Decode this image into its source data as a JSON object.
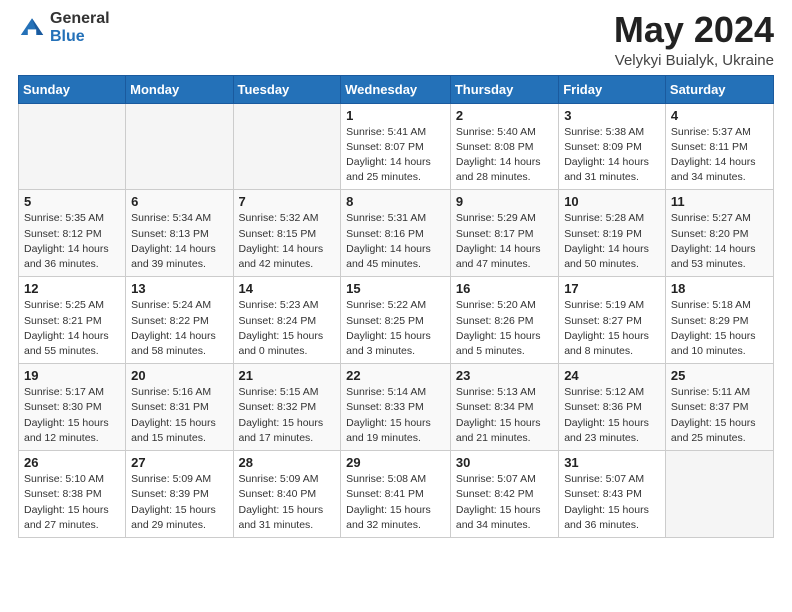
{
  "header": {
    "logo_general": "General",
    "logo_blue": "Blue",
    "title": "May 2024",
    "subtitle": "Velykyi Buialyk, Ukraine"
  },
  "columns": [
    "Sunday",
    "Monday",
    "Tuesday",
    "Wednesday",
    "Thursday",
    "Friday",
    "Saturday"
  ],
  "weeks": [
    [
      {
        "day": "",
        "info": ""
      },
      {
        "day": "",
        "info": ""
      },
      {
        "day": "",
        "info": ""
      },
      {
        "day": "1",
        "info": "Sunrise: 5:41 AM\nSunset: 8:07 PM\nDaylight: 14 hours\nand 25 minutes."
      },
      {
        "day": "2",
        "info": "Sunrise: 5:40 AM\nSunset: 8:08 PM\nDaylight: 14 hours\nand 28 minutes."
      },
      {
        "day": "3",
        "info": "Sunrise: 5:38 AM\nSunset: 8:09 PM\nDaylight: 14 hours\nand 31 minutes."
      },
      {
        "day": "4",
        "info": "Sunrise: 5:37 AM\nSunset: 8:11 PM\nDaylight: 14 hours\nand 34 minutes."
      }
    ],
    [
      {
        "day": "5",
        "info": "Sunrise: 5:35 AM\nSunset: 8:12 PM\nDaylight: 14 hours\nand 36 minutes."
      },
      {
        "day": "6",
        "info": "Sunrise: 5:34 AM\nSunset: 8:13 PM\nDaylight: 14 hours\nand 39 minutes."
      },
      {
        "day": "7",
        "info": "Sunrise: 5:32 AM\nSunset: 8:15 PM\nDaylight: 14 hours\nand 42 minutes."
      },
      {
        "day": "8",
        "info": "Sunrise: 5:31 AM\nSunset: 8:16 PM\nDaylight: 14 hours\nand 45 minutes."
      },
      {
        "day": "9",
        "info": "Sunrise: 5:29 AM\nSunset: 8:17 PM\nDaylight: 14 hours\nand 47 minutes."
      },
      {
        "day": "10",
        "info": "Sunrise: 5:28 AM\nSunset: 8:19 PM\nDaylight: 14 hours\nand 50 minutes."
      },
      {
        "day": "11",
        "info": "Sunrise: 5:27 AM\nSunset: 8:20 PM\nDaylight: 14 hours\nand 53 minutes."
      }
    ],
    [
      {
        "day": "12",
        "info": "Sunrise: 5:25 AM\nSunset: 8:21 PM\nDaylight: 14 hours\nand 55 minutes."
      },
      {
        "day": "13",
        "info": "Sunrise: 5:24 AM\nSunset: 8:22 PM\nDaylight: 14 hours\nand 58 minutes."
      },
      {
        "day": "14",
        "info": "Sunrise: 5:23 AM\nSunset: 8:24 PM\nDaylight: 15 hours\nand 0 minutes."
      },
      {
        "day": "15",
        "info": "Sunrise: 5:22 AM\nSunset: 8:25 PM\nDaylight: 15 hours\nand 3 minutes."
      },
      {
        "day": "16",
        "info": "Sunrise: 5:20 AM\nSunset: 8:26 PM\nDaylight: 15 hours\nand 5 minutes."
      },
      {
        "day": "17",
        "info": "Sunrise: 5:19 AM\nSunset: 8:27 PM\nDaylight: 15 hours\nand 8 minutes."
      },
      {
        "day": "18",
        "info": "Sunrise: 5:18 AM\nSunset: 8:29 PM\nDaylight: 15 hours\nand 10 minutes."
      }
    ],
    [
      {
        "day": "19",
        "info": "Sunrise: 5:17 AM\nSunset: 8:30 PM\nDaylight: 15 hours\nand 12 minutes."
      },
      {
        "day": "20",
        "info": "Sunrise: 5:16 AM\nSunset: 8:31 PM\nDaylight: 15 hours\nand 15 minutes."
      },
      {
        "day": "21",
        "info": "Sunrise: 5:15 AM\nSunset: 8:32 PM\nDaylight: 15 hours\nand 17 minutes."
      },
      {
        "day": "22",
        "info": "Sunrise: 5:14 AM\nSunset: 8:33 PM\nDaylight: 15 hours\nand 19 minutes."
      },
      {
        "day": "23",
        "info": "Sunrise: 5:13 AM\nSunset: 8:34 PM\nDaylight: 15 hours\nand 21 minutes."
      },
      {
        "day": "24",
        "info": "Sunrise: 5:12 AM\nSunset: 8:36 PM\nDaylight: 15 hours\nand 23 minutes."
      },
      {
        "day": "25",
        "info": "Sunrise: 5:11 AM\nSunset: 8:37 PM\nDaylight: 15 hours\nand 25 minutes."
      }
    ],
    [
      {
        "day": "26",
        "info": "Sunrise: 5:10 AM\nSunset: 8:38 PM\nDaylight: 15 hours\nand 27 minutes."
      },
      {
        "day": "27",
        "info": "Sunrise: 5:09 AM\nSunset: 8:39 PM\nDaylight: 15 hours\nand 29 minutes."
      },
      {
        "day": "28",
        "info": "Sunrise: 5:09 AM\nSunset: 8:40 PM\nDaylight: 15 hours\nand 31 minutes."
      },
      {
        "day": "29",
        "info": "Sunrise: 5:08 AM\nSunset: 8:41 PM\nDaylight: 15 hours\nand 32 minutes."
      },
      {
        "day": "30",
        "info": "Sunrise: 5:07 AM\nSunset: 8:42 PM\nDaylight: 15 hours\nand 34 minutes."
      },
      {
        "day": "31",
        "info": "Sunrise: 5:07 AM\nSunset: 8:43 PM\nDaylight: 15 hours\nand 36 minutes."
      },
      {
        "day": "",
        "info": ""
      }
    ]
  ]
}
